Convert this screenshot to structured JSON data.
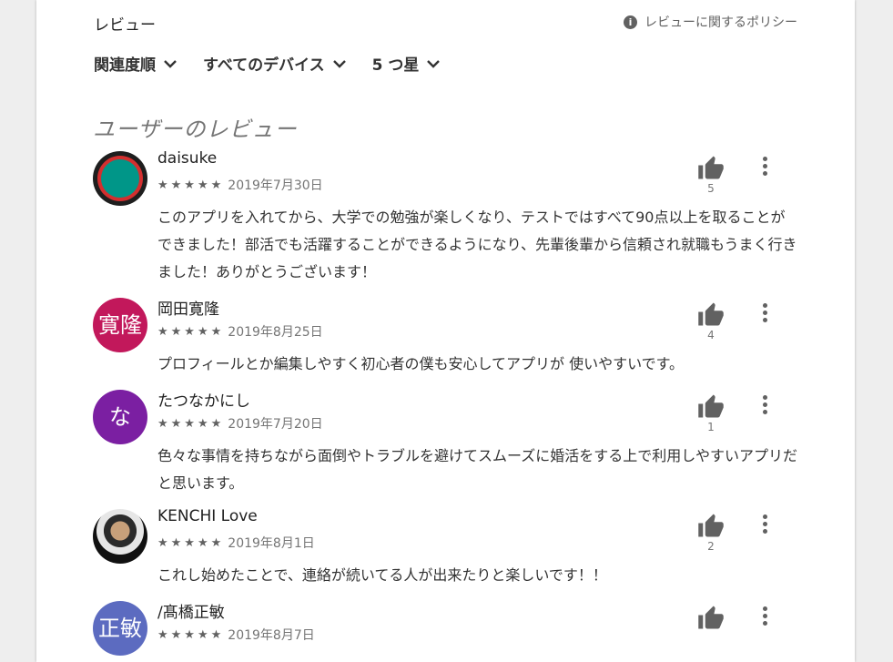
{
  "header": {
    "title": "レビュー",
    "policy_label": "レビューに関するポリシー",
    "info_icon": "i"
  },
  "filters": [
    {
      "label": "関連度順"
    },
    {
      "label": "すべてのデバイス"
    },
    {
      "label": "5 つ星"
    }
  ],
  "section_title": "ユーザーのレビュー",
  "reviews": [
    {
      "name": "daisuke",
      "stars": "★★★★★",
      "date": "2019年7月30日",
      "text": "このアプリを入れてから、大学での勉強が楽しくなり、テストではすべて90点以上を取ることができました！部活でも活躍することができるようになり、先輩後輩から信頼され就職もうまく行きました！ありがとうございます！",
      "helpful": "5",
      "avatar_text": "",
      "avatar_color": "#009688"
    },
    {
      "name": "岡田寛隆",
      "stars": "★★★★★",
      "date": "2019年8月25日",
      "text": "プロフィールとか編集しやすく初心者の僕も安心してアプリが 使いやすいです。",
      "helpful": "4",
      "avatar_text": "寛隆",
      "avatar_color": "#c2185b"
    },
    {
      "name": "たつなかにし",
      "stars": "★★★★★",
      "date": "2019年7月20日",
      "text": "色々な事情を持ちながら面倒やトラブルを避けてスムーズに婚活をする上で利用しやすいアプリだと思います。",
      "helpful": "1",
      "avatar_text": "な",
      "avatar_color": "#7b1fa2"
    },
    {
      "name": "KENCHI Love",
      "stars": "★★★★★",
      "date": "2019年8月1日",
      "text": "これし始めたことで、連絡が続いてる人が出来たりと楽しいです！！",
      "helpful": "2",
      "avatar_text": "",
      "avatar_color": "#111111"
    },
    {
      "name": "/髙橋正敏",
      "stars": "★★★★★",
      "date": "2019年8月7日",
      "text": "",
      "helpful": "",
      "avatar_text": "正敏",
      "avatar_color": "#5c6bc0"
    }
  ]
}
